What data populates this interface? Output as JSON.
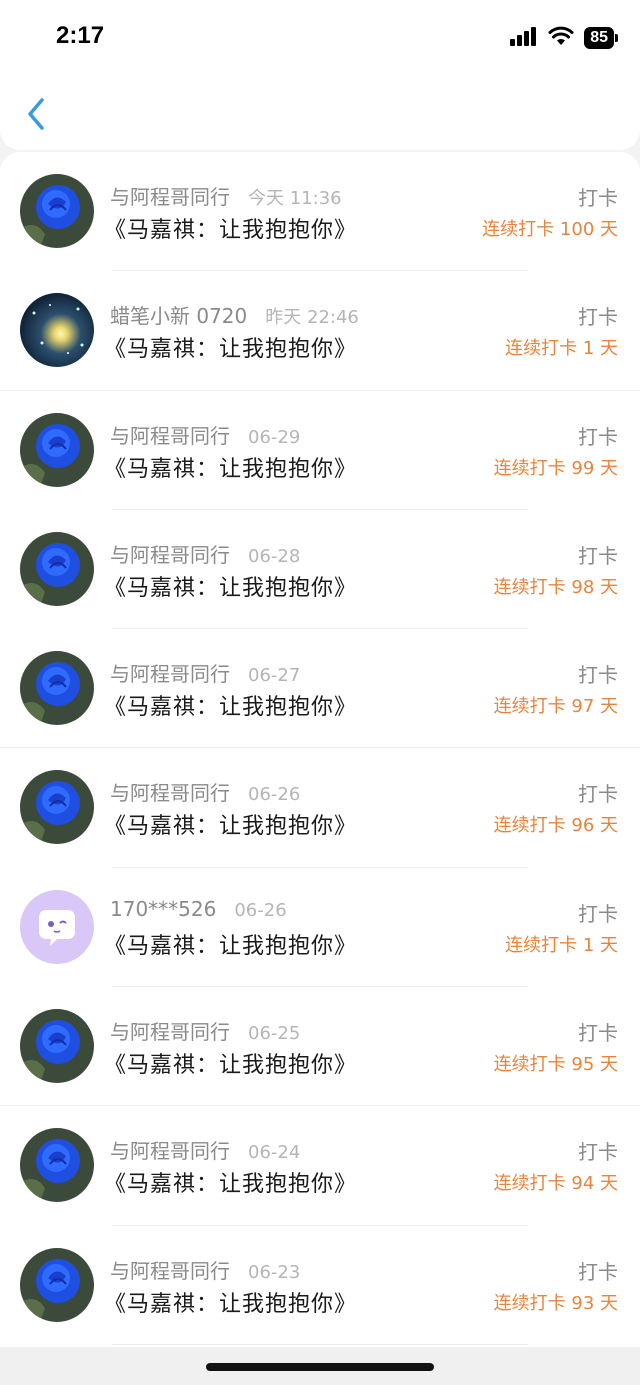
{
  "status_bar": {
    "time": "2:17",
    "battery": "85"
  },
  "nav": {
    "back_icon": "chevron-left-icon"
  },
  "colors": {
    "accent": "#3a9bdc",
    "streak": "#e8843c",
    "muted": "#8a8a8a"
  },
  "entries": [
    {
      "author": "与阿程哥同行",
      "date": "今天 11:36",
      "title": "《马嘉祺：让我抱抱你》",
      "action": "打卡",
      "streak": "连续打卡 100 天",
      "avatar": "blue-rose-avatar"
    },
    {
      "author": "蜡笔小新 0720",
      "date": "昨天 22:46",
      "title": "《马嘉祺：让我抱抱你》",
      "action": "打卡",
      "streak": "连续打卡 1 天",
      "avatar": "night-sky-avatar"
    },
    {
      "author": "与阿程哥同行",
      "date": "06-29",
      "title": "《马嘉祺：让我抱抱你》",
      "action": "打卡",
      "streak": "连续打卡 99 天",
      "avatar": "blue-rose-avatar"
    },
    {
      "author": "与阿程哥同行",
      "date": "06-28",
      "title": "《马嘉祺：让我抱抱你》",
      "action": "打卡",
      "streak": "连续打卡 98 天",
      "avatar": "blue-rose-avatar"
    },
    {
      "author": "与阿程哥同行",
      "date": "06-27",
      "title": "《马嘉祺：让我抱抱你》",
      "action": "打卡",
      "streak": "连续打卡 97 天",
      "avatar": "blue-rose-avatar"
    },
    {
      "author": "与阿程哥同行",
      "date": "06-26",
      "title": "《马嘉祺：让我抱抱你》",
      "action": "打卡",
      "streak": "连续打卡 96 天",
      "avatar": "blue-rose-avatar"
    },
    {
      "author": "170***526",
      "date": "06-26",
      "title": "《马嘉祺：让我抱抱你》",
      "action": "打卡",
      "streak": "连续打卡 1 天",
      "avatar": "chat-bubble-avatar"
    },
    {
      "author": "与阿程哥同行",
      "date": "06-25",
      "title": "《马嘉祺：让我抱抱你》",
      "action": "打卡",
      "streak": "连续打卡 95 天",
      "avatar": "blue-rose-avatar"
    },
    {
      "author": "与阿程哥同行",
      "date": "06-24",
      "title": "《马嘉祺：让我抱抱你》",
      "action": "打卡",
      "streak": "连续打卡 94 天",
      "avatar": "blue-rose-avatar"
    },
    {
      "author": "与阿程哥同行",
      "date": "06-23",
      "title": "《马嘉祺：让我抱抱你》",
      "action": "打卡",
      "streak": "连续打卡 93 天",
      "avatar": "blue-rose-avatar"
    }
  ]
}
